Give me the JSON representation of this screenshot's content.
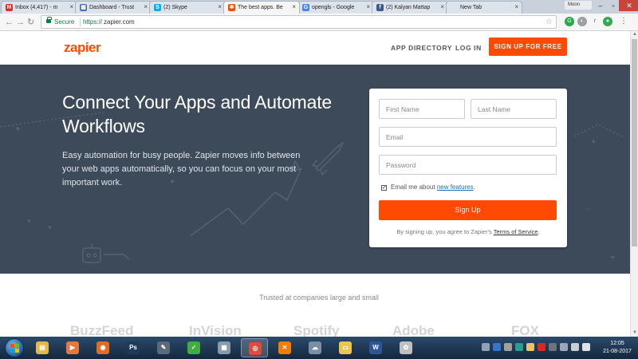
{
  "browser": {
    "tabs": [
      {
        "title": "Inbox (4,417) - m",
        "fav": "M",
        "fav_color": "#d93025"
      },
      {
        "title": "Dashboard - Trust",
        "fav": "▦",
        "fav_color": "#4a6da7"
      },
      {
        "title": "(2) Skype",
        "fav": "S",
        "fav_color": "#00aff0"
      },
      {
        "title": "The best apps. Be",
        "fav": "✱",
        "fav_color": "#ff4a00",
        "active": true
      },
      {
        "title": "opengls - Google",
        "fav": "G",
        "fav_color": "#4285f4"
      },
      {
        "title": "(2) Kalyan Mattap",
        "fav": "f",
        "fav_color": "#3b5998"
      },
      {
        "title": "New Tab",
        "fav": "",
        "fav_color": "#dce3ea"
      }
    ],
    "profile_name": "Moon",
    "address": {
      "secure_label": "Secure",
      "protocol": "https://",
      "host": "zapier.com"
    }
  },
  "site": {
    "logo": {
      "brand": "zapier"
    },
    "nav": {
      "app_directory": "APP DIRECTORY",
      "log_in": "LOG IN",
      "signup_cta": "SIGN UP FOR FREE"
    },
    "hero": {
      "headline": "Connect Your Apps and Automate Workflows",
      "subtext": "Easy automation for busy people. Zapier moves info between your web apps automatically, so you can focus on your most important work."
    },
    "form": {
      "first_name_placeholder": "First Name",
      "last_name_placeholder": "Last Name",
      "email_placeholder": "Email",
      "password_placeholder": "Password",
      "opt_in_prefix": "Email me about ",
      "opt_in_link": "new features",
      "opt_in_suffix": ".",
      "opt_in_checked": true,
      "submit_label": "Sign Up",
      "terms_prefix": "By signing up, you agree to Zapier's ",
      "terms_link": "Terms of Service",
      "terms_suffix": "."
    },
    "trusted": {
      "heading": "Trusted at companies large and small",
      "companies": [
        "BuzzFeed",
        "InVision",
        "Spotify",
        "Adobe",
        "FOX"
      ]
    },
    "colors": {
      "brand_orange": "#ff4a00",
      "hero_bg": "#3d4a5a"
    }
  },
  "taskbar": {
    "apps": [
      {
        "name": "explorer-icon",
        "glyph": "▤",
        "color": "#e6b84a"
      },
      {
        "name": "media-player-icon",
        "glyph": "▶",
        "color": "#e6783a"
      },
      {
        "name": "firefox-icon",
        "glyph": "◉",
        "color": "#e66a1f"
      },
      {
        "name": "photoshop-icon",
        "glyph": "Ps",
        "color": "#1d3a5c"
      },
      {
        "name": "tool-icon",
        "glyph": "✎",
        "color": "#5a6a7a"
      },
      {
        "name": "green-app-icon",
        "glyph": "✓",
        "color": "#3fae3f"
      },
      {
        "name": "calculator-icon",
        "glyph": "▦",
        "color": "#8a9aaa"
      },
      {
        "name": "chrome-icon",
        "glyph": "◎",
        "color": "#dd4b39",
        "active": true
      },
      {
        "name": "xampp-icon",
        "glyph": "✕",
        "color": "#f57c00"
      },
      {
        "name": "network-icon",
        "glyph": "☁",
        "color": "#7a8fa6"
      },
      {
        "name": "folder-icon",
        "glyph": "▭",
        "color": "#e8c74a"
      },
      {
        "name": "word-icon",
        "glyph": "W",
        "color": "#2b579a"
      },
      {
        "name": "paint-icon",
        "glyph": "✿",
        "color": "#c0c0c0"
      }
    ],
    "clock": {
      "time": "12:05",
      "date": "21-08-2017"
    }
  }
}
